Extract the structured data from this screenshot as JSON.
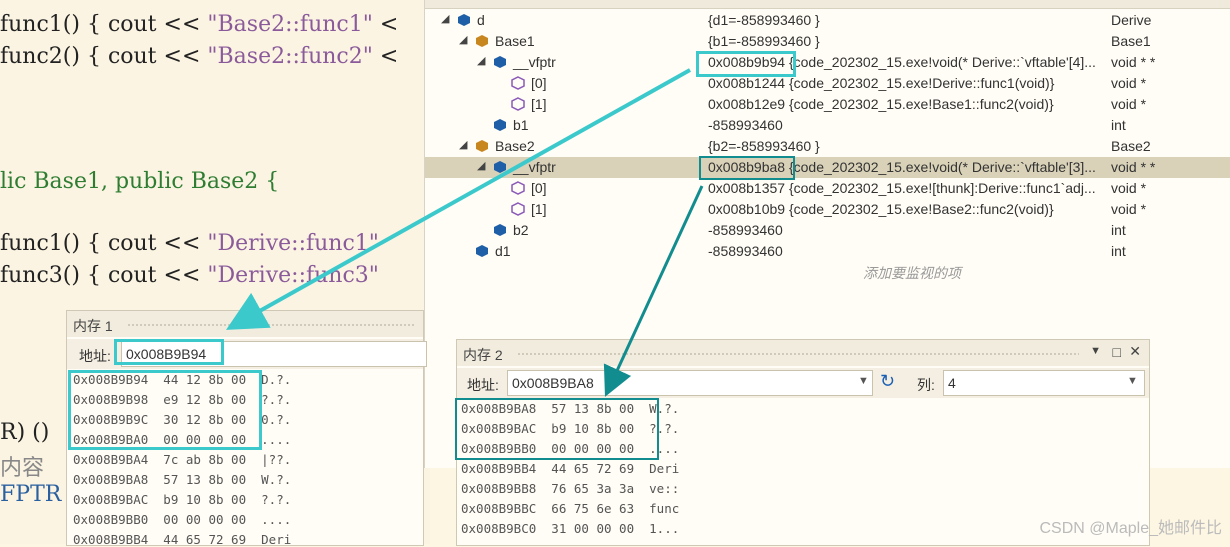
{
  "code": {
    "lines": [
      {
        "t1": "func1() { cout << ",
        "s": "\"Base2::func1\"",
        "t2": " <"
      },
      {
        "t1": "func2() { cout << ",
        "s": "\"Base2::func2\"",
        "t2": " <"
      },
      {
        "t1": "lic ",
        "k": "Base1, public Base2 {"
      },
      {
        "t1": "func1() { cout << ",
        "s": "\"Derive::func1\""
      },
      {
        "t1": "func3() { cout << ",
        "s": "\"Derive::func3\""
      },
      {
        "t1": "R) ()"
      },
      {
        "t1": "内容"
      },
      {
        "t1": "FPTR"
      }
    ]
  },
  "watch": {
    "rows": [
      {
        "name": "d",
        "value": "{d1=-858993460 }",
        "type": "Derive"
      },
      {
        "name": "Base1",
        "value": "{b1=-858993460 }",
        "type": "Base1"
      },
      {
        "name": "__vfptr",
        "value": "0x008b9b94 {code_202302_15.exe!void(* Derive::`vftable'[4]...",
        "type": "void * *"
      },
      {
        "name": "[0]",
        "value": "0x008b1244 {code_202302_15.exe!Derive::func1(void)}",
        "type": "void *"
      },
      {
        "name": "[1]",
        "value": "0x008b12e9 {code_202302_15.exe!Base1::func2(void)}",
        "type": "void *"
      },
      {
        "name": "b1",
        "value": "-858993460",
        "type": "int"
      },
      {
        "name": "Base2",
        "value": "{b2=-858993460 }",
        "type": "Base2"
      },
      {
        "name": "__vfptr",
        "value": "0x008b9ba8 {code_202302_15.exe!void(* Derive::`vftable'[3]...",
        "type": "void * *"
      },
      {
        "name": "[0]",
        "value": "0x008b1357 {code_202302_15.exe![thunk]:Derive::func1`adj...",
        "type": "void *"
      },
      {
        "name": "[1]",
        "value": "0x008b10b9 {code_202302_15.exe!Base2::func2(void)}",
        "type": "void *"
      },
      {
        "name": "b2",
        "value": "-858993460",
        "type": "int"
      },
      {
        "name": "d1",
        "value": "-858993460",
        "type": "int"
      }
    ],
    "add_watch": "添加要监视的项"
  },
  "mem1": {
    "title": "内存 1",
    "address_label": "地址:",
    "address": "0x008B9B94",
    "rows": [
      "0x008B9B94  44 12 8b 00  D.?.",
      "0x008B9B98  e9 12 8b 00  ?.?.",
      "0x008B9B9C  30 12 8b 00  0.?.",
      "0x008B9BA0  00 00 00 00  ....",
      "0x008B9BA4  7c ab 8b 00  |??.",
      "0x008B9BA8  57 13 8b 00  W.?.",
      "0x008B9BAC  b9 10 8b 00  ?.?.",
      "0x008B9BB0  00 00 00 00  ....",
      "0x008B9BB4  44 65 72 69  Deri"
    ]
  },
  "mem2": {
    "title": "内存 2",
    "address_label": "地址:",
    "address": "0x008B9BA8",
    "col_label": "列:",
    "col_value": "4",
    "rows": [
      "0x008B9BA8  57 13 8b 00  W.?.",
      "0x008B9BAC  b9 10 8b 00  ?.?.",
      "0x008B9BB0  00 00 00 00  ....",
      "0x008B9BB4  44 65 72 69  Deri",
      "0x008B9BB8  76 65 3a 3a  ve::",
      "0x008B9BBC  66 75 6e 63  func",
      "0x008B9BC0  31 00 00 00  1..."
    ]
  },
  "watermark": "CSDN @Maple_她邮件比"
}
